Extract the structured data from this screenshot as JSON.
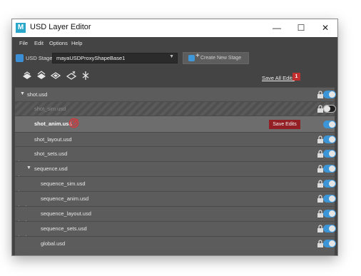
{
  "window": {
    "title": "USD Layer Editor",
    "minimize": "—",
    "maximize": "☐",
    "close": "✕"
  },
  "menu": {
    "items": [
      "File",
      "Edit",
      "Options",
      "Help"
    ]
  },
  "stage": {
    "label": "USD Stage:",
    "value": "mayaUSDProxyShapeBase1",
    "create_button": "Create New Stage"
  },
  "toolbar": {
    "icons": [
      "add-layer-icon",
      "load-layer-icon",
      "sublayer-icon",
      "insert-layer-icon",
      "merge-icon"
    ],
    "save_all_label": "Save All Edits",
    "save_all_count": "1"
  },
  "layers": [
    {
      "name": "shot.usd",
      "indent": 0,
      "expand": "expanded",
      "locked": true,
      "visible": true,
      "state": "normal"
    },
    {
      "name": "shot_sim.usd",
      "indent": 1,
      "expand": "none",
      "locked": true,
      "visible": false,
      "state": "muted"
    },
    {
      "name": "shot_anim.usd",
      "indent": 1,
      "expand": "none",
      "locked": false,
      "visible": true,
      "state": "selected",
      "save_label": "Save Edits"
    },
    {
      "name": "shot_layout.usd",
      "indent": 1,
      "expand": "none",
      "locked": true,
      "visible": true,
      "state": "normal"
    },
    {
      "name": "shot_sets.usd",
      "indent": 1,
      "expand": "none",
      "locked": true,
      "visible": true,
      "state": "normal"
    },
    {
      "name": "sequence.usd",
      "indent": 1,
      "expand": "expanded",
      "locked": true,
      "visible": true,
      "state": "normal"
    },
    {
      "name": "sequence_sim.usd",
      "indent": 2,
      "expand": "none",
      "locked": true,
      "visible": true,
      "state": "normal"
    },
    {
      "name": "sequence_anim.usd",
      "indent": 2,
      "expand": "none",
      "locked": true,
      "visible": true,
      "state": "normal"
    },
    {
      "name": "sequence_layout.usd",
      "indent": 2,
      "expand": "none",
      "locked": true,
      "visible": true,
      "state": "normal"
    },
    {
      "name": "sequence_sets.usd",
      "indent": 2,
      "expand": "none",
      "locked": true,
      "visible": true,
      "state": "normal"
    },
    {
      "name": "global.usd",
      "indent": 2,
      "expand": "none",
      "locked": true,
      "visible": true,
      "state": "normal"
    }
  ],
  "colors": {
    "accent": "#3c95d6",
    "save_edits": "#931f24",
    "badge": "#c12f2f"
  }
}
